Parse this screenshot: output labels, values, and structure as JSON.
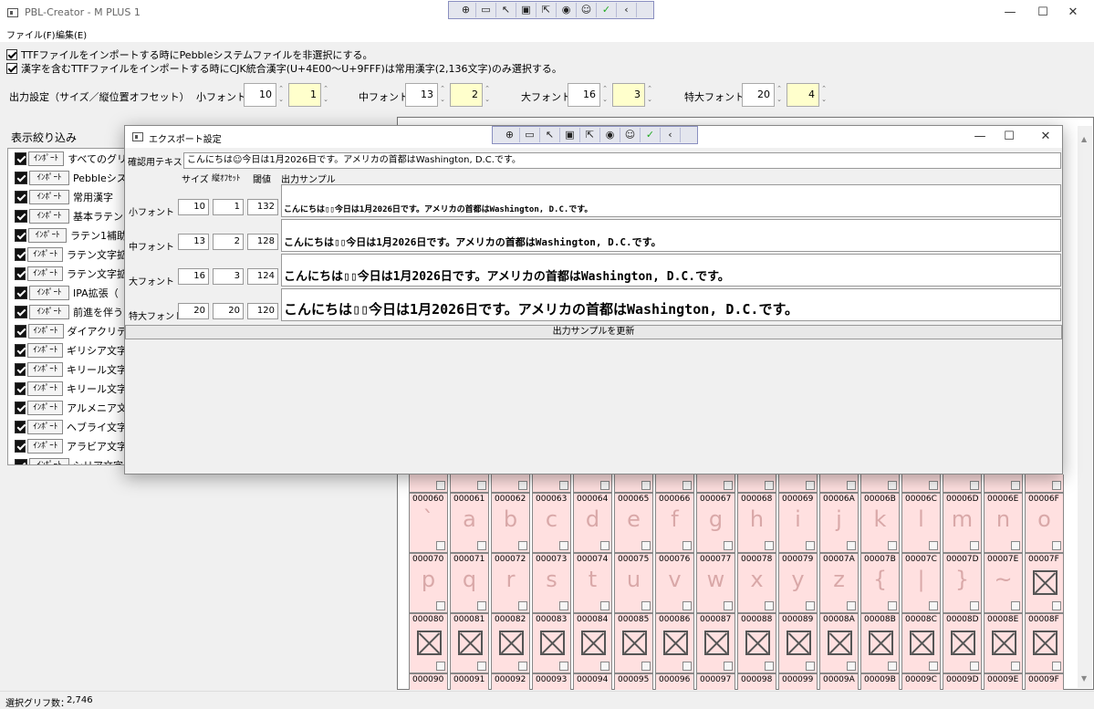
{
  "window": {
    "title": "PBL-Creator - M PLUS 1",
    "min": "—",
    "max": "☐",
    "close": "✕"
  },
  "debug_toolbar": {
    "icons": [
      "⊕",
      "▭",
      "↖",
      "▣",
      "⇱",
      "◉",
      "☺",
      "✓",
      "‹"
    ]
  },
  "menu": {
    "file": "ファイル(F)",
    "edit": "編集(E)"
  },
  "options": {
    "opt1": "TTFファイルをインポートする時にPebbleシステムファイルを非選択にする。",
    "opt2": "漢字を含むTTFファイルをインポートする時にCJK統合漢字(U+4E00～U+9FFF)は常用漢字(2,136文字)のみ選択する。"
  },
  "output_settings": {
    "label": "出力設定（サイズ／縦位置オフセット）",
    "sizes": [
      {
        "label": "小フォント",
        "size": "10",
        "offset": "1"
      },
      {
        "label": "中フォント",
        "size": "13",
        "offset": "2"
      },
      {
        "label": "大フォント",
        "size": "16",
        "offset": "3"
      },
      {
        "label": "特大フォント",
        "size": "20",
        "offset": "4"
      }
    ]
  },
  "filter": {
    "label": "表示絞り込み",
    "import_label": "ｲﾝﾎﾟｰﾄ",
    "items": [
      "すべてのグリ",
      "Pebbleシス",
      "常用漢字",
      "基本ラテン",
      "ラテン1補助",
      "ラテン文字拡",
      "ラテン文字拡",
      "IPA拡張（",
      "前進を伴う",
      "ダイアクリテ",
      "ギリシア文字",
      "キリール文字",
      "キリール文字",
      "アルメニア文",
      "ヘブライ文字",
      "アラビア文字",
      "シリア文字"
    ]
  },
  "glyph_grid": {
    "rows": [
      {
        "codes": [
          "000060",
          "000061",
          "000062",
          "000063",
          "000064",
          "000065",
          "000066",
          "000067",
          "000068",
          "000069",
          "00006A",
          "00006B",
          "00006C",
          "00006D",
          "00006E",
          "00006F"
        ],
        "glyphs": [
          "`",
          "a",
          "b",
          "c",
          "d",
          "e",
          "f",
          "g",
          "h",
          "i",
          "j",
          "k",
          "l",
          "m",
          "n",
          "o"
        ]
      },
      {
        "codes": [
          "000070",
          "000071",
          "000072",
          "000073",
          "000074",
          "000075",
          "000076",
          "000077",
          "000078",
          "000079",
          "00007A",
          "00007B",
          "00007C",
          "00007D",
          "00007E",
          "00007F"
        ],
        "glyphs": [
          "p",
          "q",
          "r",
          "s",
          "t",
          "u",
          "v",
          "w",
          "x",
          "y",
          "z",
          "{",
          "|",
          "}",
          "~",
          ""
        ]
      },
      {
        "codes": [
          "000080",
          "000081",
          "000082",
          "000083",
          "000084",
          "000085",
          "000086",
          "000087",
          "000088",
          "000089",
          "00008A",
          "00008B",
          "00008C",
          "00008D",
          "00008E",
          "00008F"
        ],
        "glyphs": [
          "",
          "",
          "",
          "",
          "",
          "",
          "",
          "",
          "",
          "",
          "",
          "",
          "",
          "",
          "",
          ""
        ]
      },
      {
        "codes": [
          "000090",
          "000091",
          "000092",
          "000093",
          "000094",
          "000095",
          "000096",
          "000097",
          "000098",
          "000099",
          "00009A",
          "00009B",
          "00009C",
          "00009D",
          "00009E",
          "00009F"
        ],
        "glyphs": [
          "",
          "",
          "",
          "",
          "",
          "",
          "",
          "",
          "",
          "",
          "",
          "",
          "",
          "",
          "",
          ""
        ]
      }
    ]
  },
  "status": {
    "label": "選択グリフ数：",
    "value": "2,746"
  },
  "dialog": {
    "title": "エクスポート設定",
    "test_label": "確認用テキスト",
    "test_text": "こんにちは☺今日は1月2026日です。アメリカの首都はWashington, D.C.です。",
    "col_size": "サイズ",
    "col_offset": "縦ｵﾌｾｯﾄ",
    "col_threshold": "閾値",
    "col_sample": "出力サンプル",
    "rows": [
      {
        "label": "小フォント",
        "size": "10",
        "offset": "1",
        "threshold": "132",
        "sample": "こんにちは▯▯今日は1月2026日です。アメリカの首都はWashington, D.C.です。"
      },
      {
        "label": "中フォント",
        "size": "13",
        "offset": "2",
        "threshold": "128",
        "sample": "こんにちは▯▯今日は1月2026日です。アメリカの首都はWashington, D.C.です。"
      },
      {
        "label": "大フォント",
        "size": "16",
        "offset": "3",
        "threshold": "124",
        "sample": "こんにちは▯▯今日は1月2026日です。アメリカの首都はWashington, D.C.です。"
      },
      {
        "label": "特大フォント",
        "size": "20",
        "offset": "20",
        "threshold": "120",
        "sample": "こんにちは▯▯今日は1月2026日です。アメリカの首都はWashington, D.C.です。"
      }
    ],
    "update_button": "出力サンプルを更新"
  }
}
